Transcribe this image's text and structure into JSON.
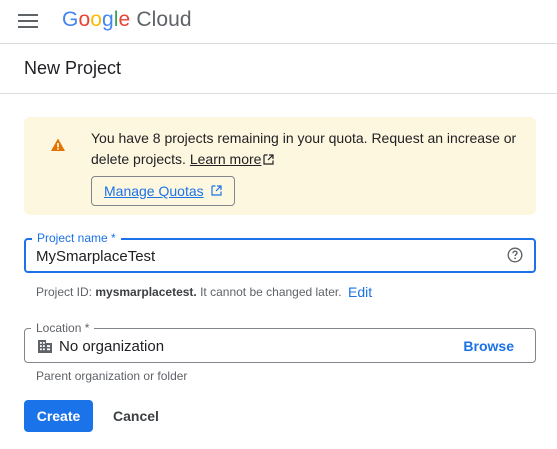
{
  "header": {
    "logo_google": "Google",
    "logo_cloud": "Cloud",
    "menu_icon": "hamburger-menu-icon"
  },
  "page": {
    "title": "New Project"
  },
  "alert": {
    "icon": "warning-icon",
    "message": "You have 8 projects remaining in your quota. Request an increase or delete projects.",
    "learn_more": "Learn more",
    "manage_quotas": "Manage Quotas",
    "background_color": "#fef7e0",
    "warning_color": "#e37400"
  },
  "project_name": {
    "label": "Project name *",
    "value": "MySmarplaceTest",
    "help_icon": "help-circle-icon"
  },
  "project_id": {
    "prefix": "Project ID:",
    "id": "mysmarplacetest.",
    "suffix": "It cannot be changed later.",
    "edit": "Edit"
  },
  "location": {
    "label": "Location *",
    "icon": "organization-icon",
    "value": "No organization",
    "browse": "Browse",
    "helper": "Parent organization or folder"
  },
  "actions": {
    "create": "Create",
    "cancel": "Cancel",
    "primary_color": "#1a73e8"
  }
}
